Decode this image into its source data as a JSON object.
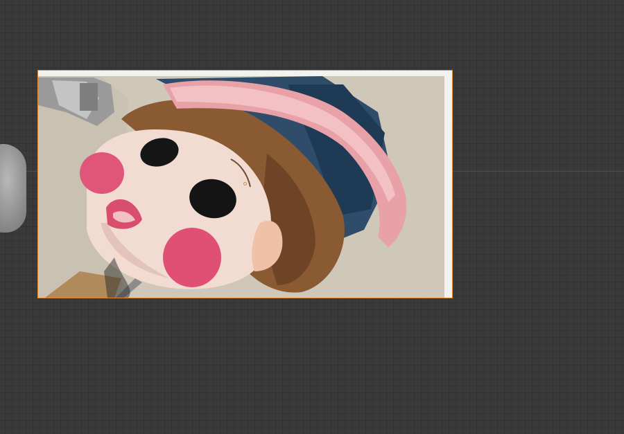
{
  "viewport": {
    "name": "3d-viewport",
    "grid": "on"
  },
  "colors": {
    "background": "#3a3a3a",
    "grid_line": "#333333",
    "x_axis": "#7a3b3b",
    "selection_outline": "#e58a2f"
  },
  "objects": {
    "image_plane": {
      "content": "doll-photo",
      "selected": true
    },
    "origin": {
      "icon": "origin-point-icon"
    },
    "side_object": {
      "icon": "mesh-object-icon"
    }
  }
}
